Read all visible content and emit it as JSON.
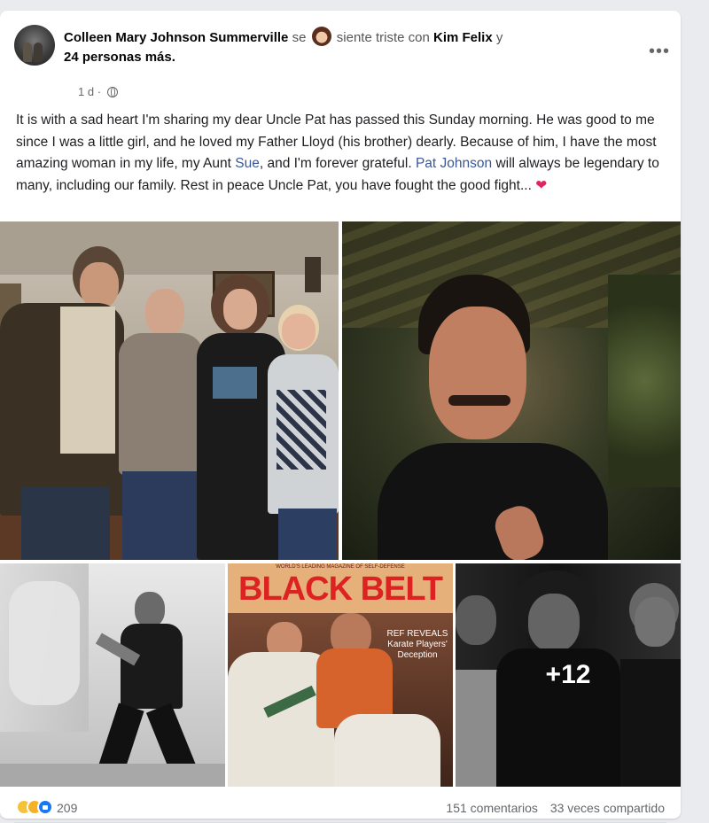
{
  "post": {
    "author": "Colleen Mary Johnson Summerville",
    "feeling_prefix": "se",
    "feeling_text": "siente triste con",
    "tagged_name": "Kim Felix",
    "tagged_conjunction": "y",
    "tagged_others": "24 personas más.",
    "time": "1 d",
    "time_separator": "·",
    "text_parts": {
      "a": "It is with a sad heart I'm sharing my dear Uncle Pat has passed this Sunday morning. He was good to me since I was a little girl, and he loved my Father Lloyd (his brother) dearly. Because of him, I have the most amazing woman in my life, my Aunt ",
      "link_sue": "Sue",
      "b": ", and I'm forever grateful. ",
      "link_pat": "Pat Johnson",
      "c": " will always be legendary to many, including our family. Rest in peace Uncle Pat, you have fought the good fight... ",
      "heart": "❤"
    },
    "more_menu": "•••"
  },
  "photos": {
    "magazine_title": "BLACK BELT",
    "magazine_top": "WORLD'S LEADING MAGAZINE OF SELF-DEFENSE",
    "magazine_callout": "REF REVEALS Karate Players' Deception",
    "more_count": "+12"
  },
  "footer": {
    "reaction_count": "209",
    "comments": "151 comentarios",
    "shares": "33 veces compartido"
  },
  "colors": {
    "link": "#385898",
    "heart": "#e0245e",
    "like": "#1877f2"
  }
}
